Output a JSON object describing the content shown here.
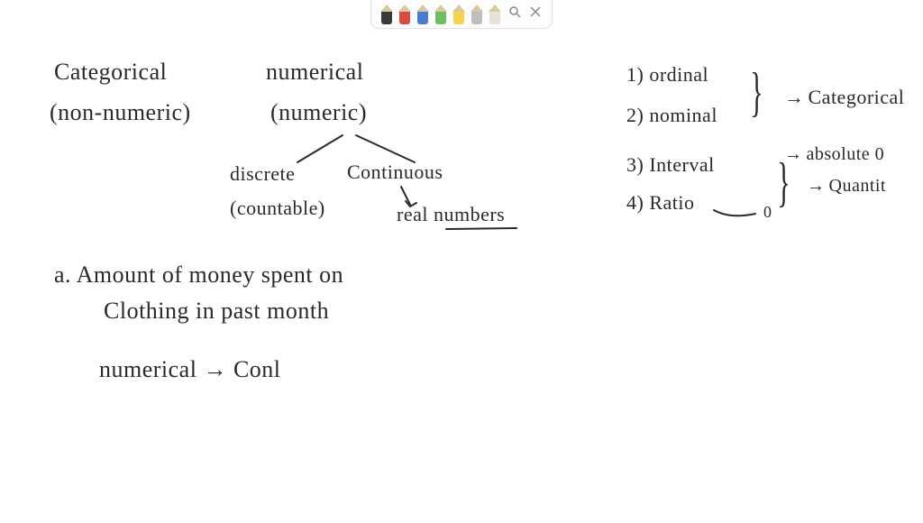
{
  "toolbar": {
    "pens": [
      {
        "name": "pen-black",
        "color": "#3a3a3a"
      },
      {
        "name": "pen-red",
        "color": "#d94b3d"
      },
      {
        "name": "pen-blue",
        "color": "#4a7bd1"
      },
      {
        "name": "pen-green",
        "color": "#6bbf5e"
      },
      {
        "name": "pen-yellow",
        "color": "#f3d44a"
      },
      {
        "name": "pen-gray",
        "color": "#bdbdbd"
      },
      {
        "name": "pen-light",
        "color": "#e7e2d8"
      }
    ],
    "search_title": "Search",
    "close_title": "Close"
  },
  "notes": {
    "cat_heading": "Categorical",
    "cat_sub": "(non-numeric)",
    "num_heading": "numerical",
    "num_sub": "(numeric)",
    "discrete": "discrete",
    "continuous": "Continuous",
    "countable": "(countable)",
    "real_numbers": "real numbers",
    "list_1": "1) ordinal",
    "list_2": "2) nominal",
    "list_3": "3) Interval",
    "list_4": "4) Ratio",
    "arrow_categorical": "Categorical",
    "arrow_absolute": "absolute 0",
    "arrow_quant": "Quantit",
    "ratio_zero": "0",
    "q_a_line1": "a. Amount of money spent on",
    "q_a_line2": "Clothing in past month",
    "answer_a": "numerical → Conl"
  }
}
